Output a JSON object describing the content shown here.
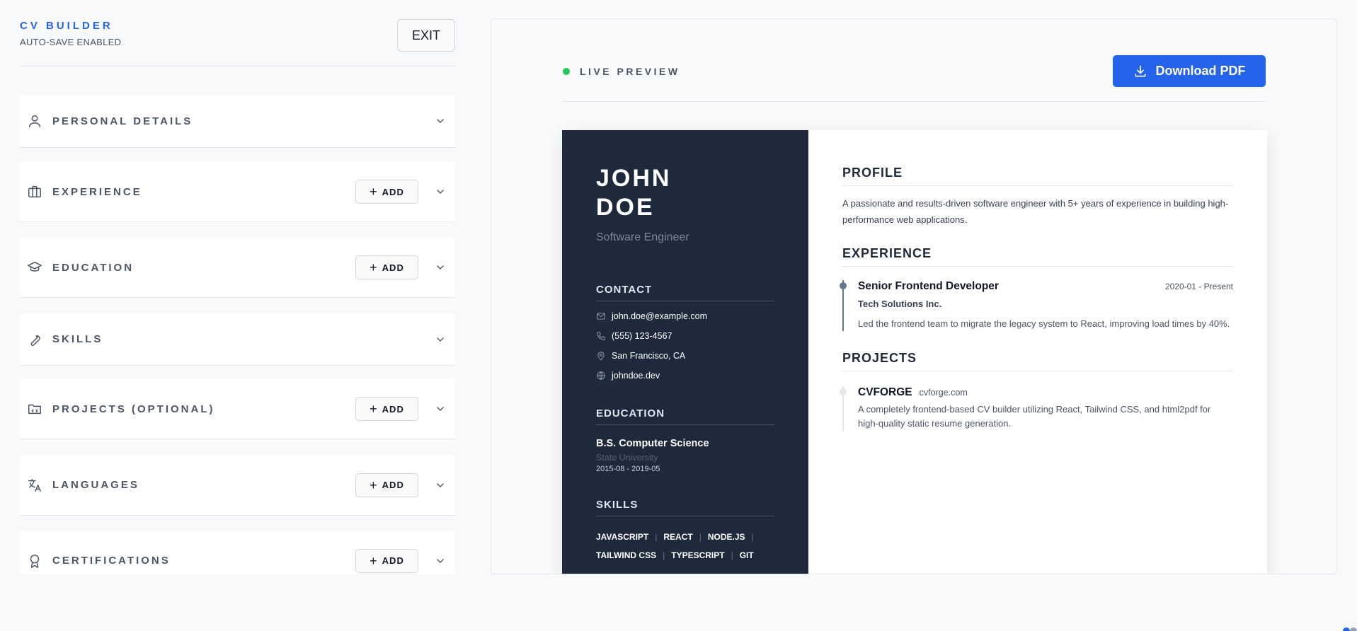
{
  "brand": {
    "title": "CV BUILDER",
    "subtitle": "AUTO-SAVE ENABLED"
  },
  "header": {
    "exit_label": "EXIT"
  },
  "sections": [
    {
      "label": "PERSONAL DETAILS",
      "icon": "person-icon",
      "has_add": false
    },
    {
      "label": "EXPERIENCE",
      "icon": "briefcase-icon",
      "has_add": true
    },
    {
      "label": "EDUCATION",
      "icon": "graduation-cap-icon",
      "has_add": true
    },
    {
      "label": "SKILLS",
      "icon": "wrench-icon",
      "has_add": false
    },
    {
      "label": "PROJECTS (OPTIONAL)",
      "icon": "folder-code-icon",
      "has_add": true
    },
    {
      "label": "LANGUAGES",
      "icon": "translate-icon",
      "has_add": true
    },
    {
      "label": "CERTIFICATIONS",
      "icon": "award-icon",
      "has_add": true
    }
  ],
  "add_label": "ADD",
  "preview": {
    "live_label": "LIVE PREVIEW",
    "download_label": "Download PDF",
    "accent_color": "#2563eb",
    "live_color": "#22c55e"
  },
  "resume": {
    "first_name": "JOHN",
    "last_name": "DOE",
    "job_title": "Software Engineer",
    "contact_heading": "CONTACT",
    "contact": {
      "email": "john.doe@example.com",
      "phone": "(555) 123-4567",
      "location": "San Francisco, CA",
      "website": "johndoe.dev"
    },
    "education_heading": "EDUCATION",
    "education": {
      "degree": "B.S. Computer Science",
      "school": "State University",
      "dates": "2015-08 - 2019-05"
    },
    "skills_heading": "SKILLS",
    "skills": [
      "JAVASCRIPT",
      "REACT",
      "NODE.JS",
      "TAILWIND CSS",
      "TYPESCRIPT",
      "GIT"
    ],
    "profile_heading": "PROFILE",
    "profile": "A passionate and results-driven software engineer with 5+ years of experience in building high-performance web applications.",
    "experience_heading": "EXPERIENCE",
    "experience": {
      "title": "Senior Frontend Developer",
      "dates": "2020-01 - Present",
      "company": "Tech Solutions Inc.",
      "description": "Led the frontend team to migrate the legacy system to React, improving load times by 40%."
    },
    "projects_heading": "PROJECTS",
    "project": {
      "name": "CVFORGE",
      "url": "cvforge.com",
      "description": "A completely frontend-based CV builder utilizing React, Tailwind CSS, and html2pdf for high-quality static resume generation."
    },
    "sidebar_color": "#1e293b"
  }
}
